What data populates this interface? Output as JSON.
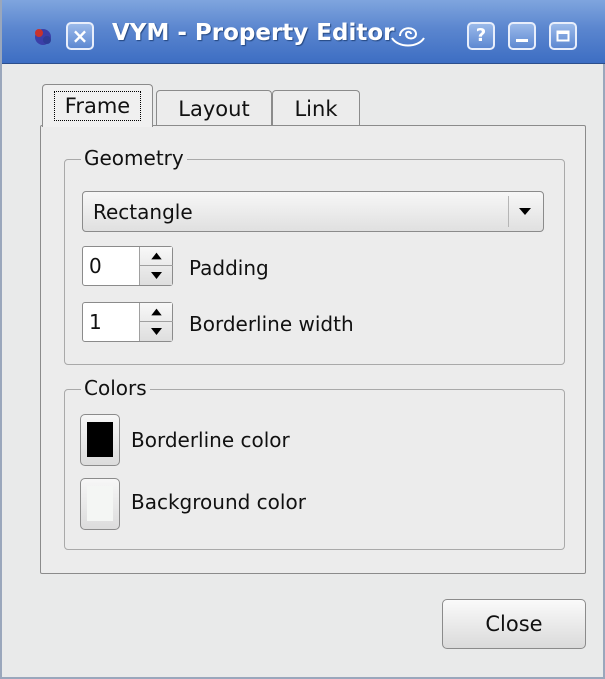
{
  "window": {
    "title": "VYM - Property Editor",
    "close_glyph": "×",
    "help_glyph": "?",
    "minimize_glyph": "▁",
    "maximize_glyph": "□",
    "titlebar_color": "#4a7ac9"
  },
  "tabs": [
    {
      "label": "Frame",
      "active": true
    },
    {
      "label": "Layout",
      "active": false
    },
    {
      "label": "Link",
      "active": false
    }
  ],
  "geometry": {
    "title": "Geometry",
    "frame_type": "Rectangle",
    "padding": {
      "value": "0",
      "label": "Padding"
    },
    "borderline_width": {
      "value": "1",
      "label": "Borderline width"
    }
  },
  "colors": {
    "title": "Colors",
    "borderline": {
      "label": "Borderline color",
      "color": "#000000"
    },
    "background": {
      "label": "Background color",
      "color": "#f4f6f4"
    }
  },
  "footer": {
    "close_label": "Close"
  },
  "icons": [
    "app-icon",
    "close-icon",
    "kde-swirl-icon",
    "help-icon",
    "minimize-icon",
    "maximize-icon",
    "chevron-down-icon",
    "spin-up-icon",
    "spin-down-icon"
  ]
}
